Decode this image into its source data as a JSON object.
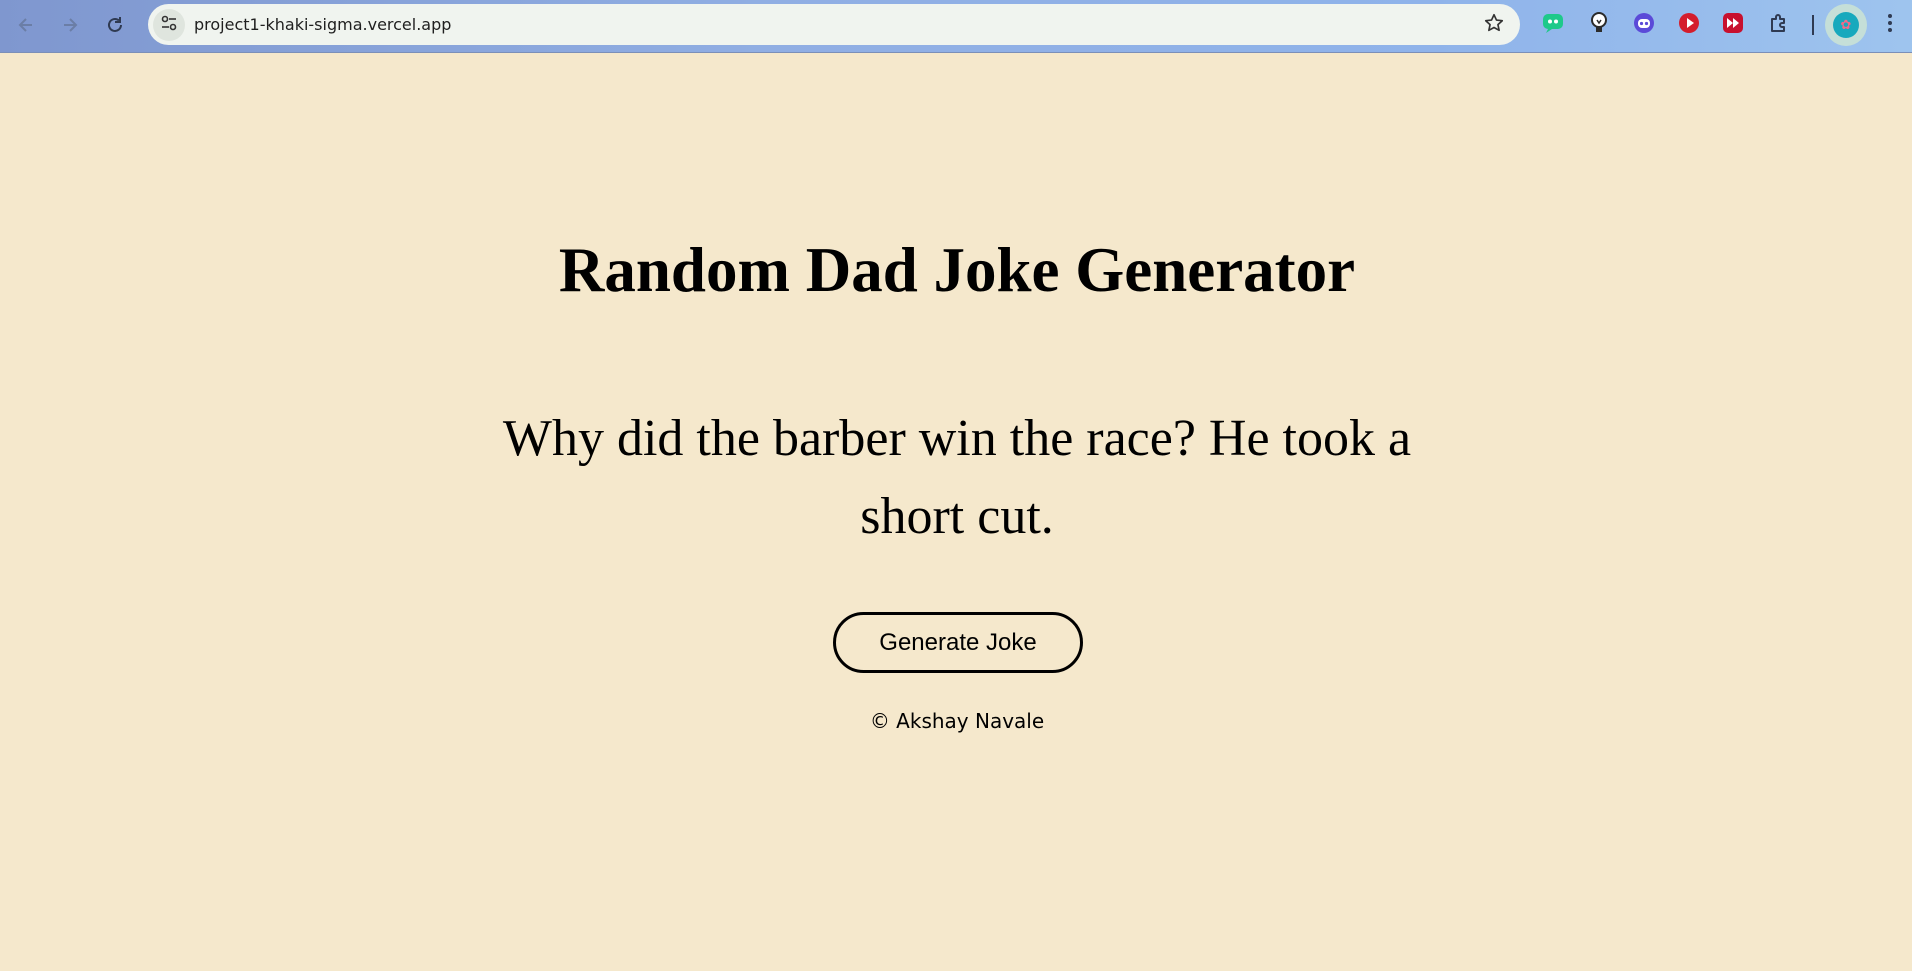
{
  "browser": {
    "url": "project1-khaki-sigma.vercel.app",
    "extensions": [
      {
        "name": "chat-extension-icon",
        "color": "#1ec98a"
      },
      {
        "name": "lightbulb-extension-icon",
        "color": "#2b2b2b"
      },
      {
        "name": "robot-extension-icon",
        "color": "#5b4ad8"
      },
      {
        "name": "play-extension-icon",
        "color": "#d41d2c"
      },
      {
        "name": "fast-forward-extension-icon",
        "color": "#c8102e"
      },
      {
        "name": "puzzle-extensions-icon",
        "color": "#2f3a52"
      }
    ]
  },
  "page": {
    "title": "Random Dad Joke Generator",
    "joke": "Why did the barber win the race? He took a short cut.",
    "button_label": "Generate Joke",
    "footer": "© Akshay Navale",
    "background_color": "#f5e8cc"
  }
}
